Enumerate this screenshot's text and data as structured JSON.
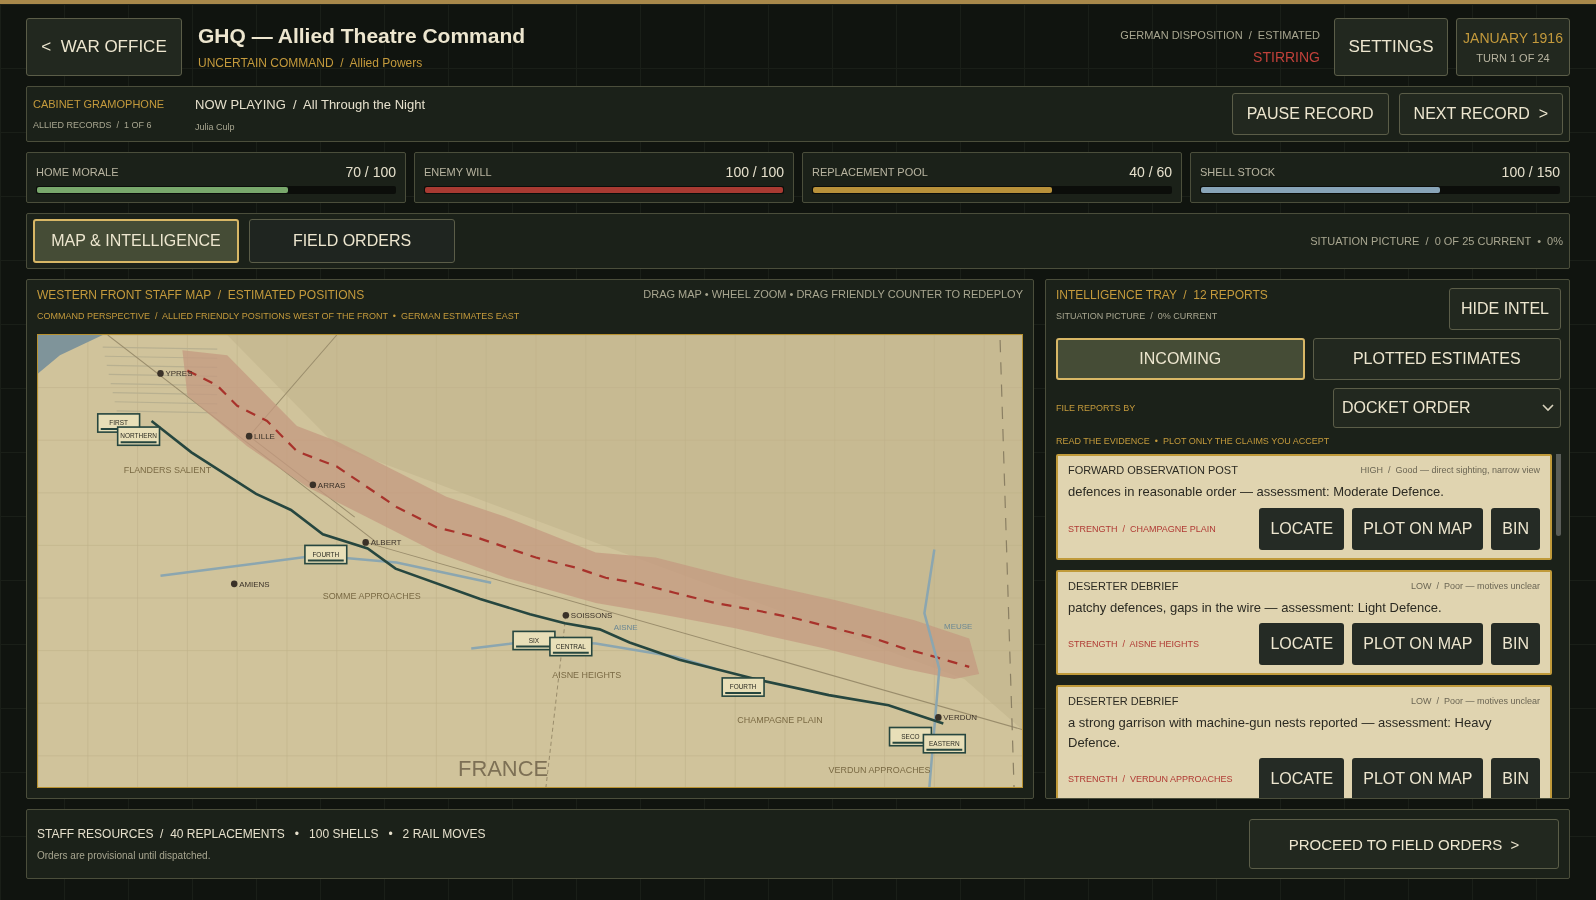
{
  "header": {
    "back_button": "<  WAR OFFICE",
    "title": "GHQ — Allied Theatre Command",
    "subtitle": "UNCERTAIN COMMAND  /  Allied Powers",
    "disposition_label": "GERMAN DISPOSITION  /  ESTIMATED",
    "disposition_value": "STIRRING",
    "settings_button": "SETTINGS",
    "date": "JANUARY 1916",
    "turn": "TURN 1 OF 24"
  },
  "gramophone": {
    "title": "CABINET GRAMOPHONE",
    "records": "ALLIED RECORDS  /  1 OF 6",
    "now_playing": "NOW PLAYING  /  All Through the Night",
    "artist": "Julia Culp",
    "buttons": [
      "PAUSE RECORD",
      "NEXT RECORD  >"
    ]
  },
  "meters": [
    {
      "name": "HOME MORALE",
      "reading": "70 / 100",
      "level": 0.7,
      "color": "#79a86c"
    },
    {
      "name": "ENEMY WILL",
      "reading": "100 / 100",
      "level": 1.0,
      "color": "#a83a32"
    },
    {
      "name": "REPLACEMENT POOL",
      "reading": "40 / 60",
      "level": 0.667,
      "color": "#b8913a"
    },
    {
      "name": "SHELL STOCK",
      "reading": "100 / 150",
      "level": 0.667,
      "color": "#88a4b8"
    }
  ],
  "tabs": [
    {
      "label": "MAP & INTELLIGENCE",
      "selected": true
    },
    {
      "label": "FIELD ORDERS",
      "selected": false
    }
  ],
  "situation": "SITUATION PICTURE  /  0 OF 25 CURRENT  •  0%",
  "map": {
    "title": "WESTERN FRONT STAFF MAP  /  ESTIMATED POSITIONS",
    "subtitle": "COMMAND PERSPECTIVE  /  ALLIED FRIENDLY POSITIONS WEST OF THE FRONT  •  GERMAN ESTIMATES EAST",
    "hint": "DRAG MAP • WHEEL ZOOM • DRAG FRIENDLY COUNTER TO REDEPLOY",
    "cities": [
      "YPRES",
      "LILLE",
      "ARRAS",
      "ALBERT",
      "AMIENS",
      "SOISSONS",
      "VERDUN"
    ],
    "regions": [
      "FLANDERS SALIENT",
      "SOMME APPROACHES",
      "AISNE HEIGHTS",
      "CHAMPAGNE PLAIN",
      "VERDUN APPROACHES"
    ],
    "rivers": [
      "AISNE",
      "MEUSE"
    ],
    "country": "FRANCE",
    "counters": [
      "FIRST",
      "NORTHERN",
      "FOURTH",
      "SIX",
      "CENTRAL",
      "FOURTH",
      "SECO",
      "EASTERN"
    ]
  },
  "intel": {
    "title": "INTELLIGENCE TRAY  /  12 REPORTS",
    "subtitle": "SITUATION PICTURE  /  0% CURRENT",
    "hide_button": "HIDE INTEL",
    "tabs": [
      {
        "label": "INCOMING",
        "selected": true
      },
      {
        "label": "PLOTTED ESTIMATES",
        "selected": false
      }
    ],
    "sort_label": "FILE REPORTS BY",
    "sort_value": "DOCKET ORDER",
    "guidance": "READ THE EVIDENCE  •  PLOT ONLY THE CLAIMS YOU ACCEPT",
    "reports": [
      {
        "source": "FORWARD OBSERVATION POST",
        "grade": "HIGH  /  Good — direct sighting, narrow view",
        "text": "defences in reasonable order — assessment: Moderate Defence.",
        "tag": "STRENGTH  /  CHAMPAGNE PLAIN",
        "actions": [
          "LOCATE",
          "PLOT ON MAP",
          "BIN"
        ]
      },
      {
        "source": "DESERTER DEBRIEF",
        "grade": "LOW  /  Poor — motives unclear",
        "text": "patchy defences, gaps in the wire — assessment: Light Defence.",
        "tag": "STRENGTH  /  AISNE HEIGHTS",
        "actions": [
          "LOCATE",
          "PLOT ON MAP",
          "BIN"
        ]
      },
      {
        "source": "DESERTER DEBRIEF",
        "grade": "LOW  /  Poor — motives unclear",
        "text": "a strong garrison with machine-gun nests reported — assessment: Heavy Defence.",
        "tag": "STRENGTH  /  VERDUN APPROACHES",
        "actions": [
          "LOCATE",
          "PLOT ON MAP",
          "BIN"
        ]
      }
    ]
  },
  "footer": {
    "resources": "STAFF RESOURCES  /  40 REPLACEMENTS   •   100 SHELLS   •   2 RAIL MOVES",
    "note": "Orders are provisional until dispatched.",
    "button": "PROCEED TO FIELD ORDERS  >"
  }
}
